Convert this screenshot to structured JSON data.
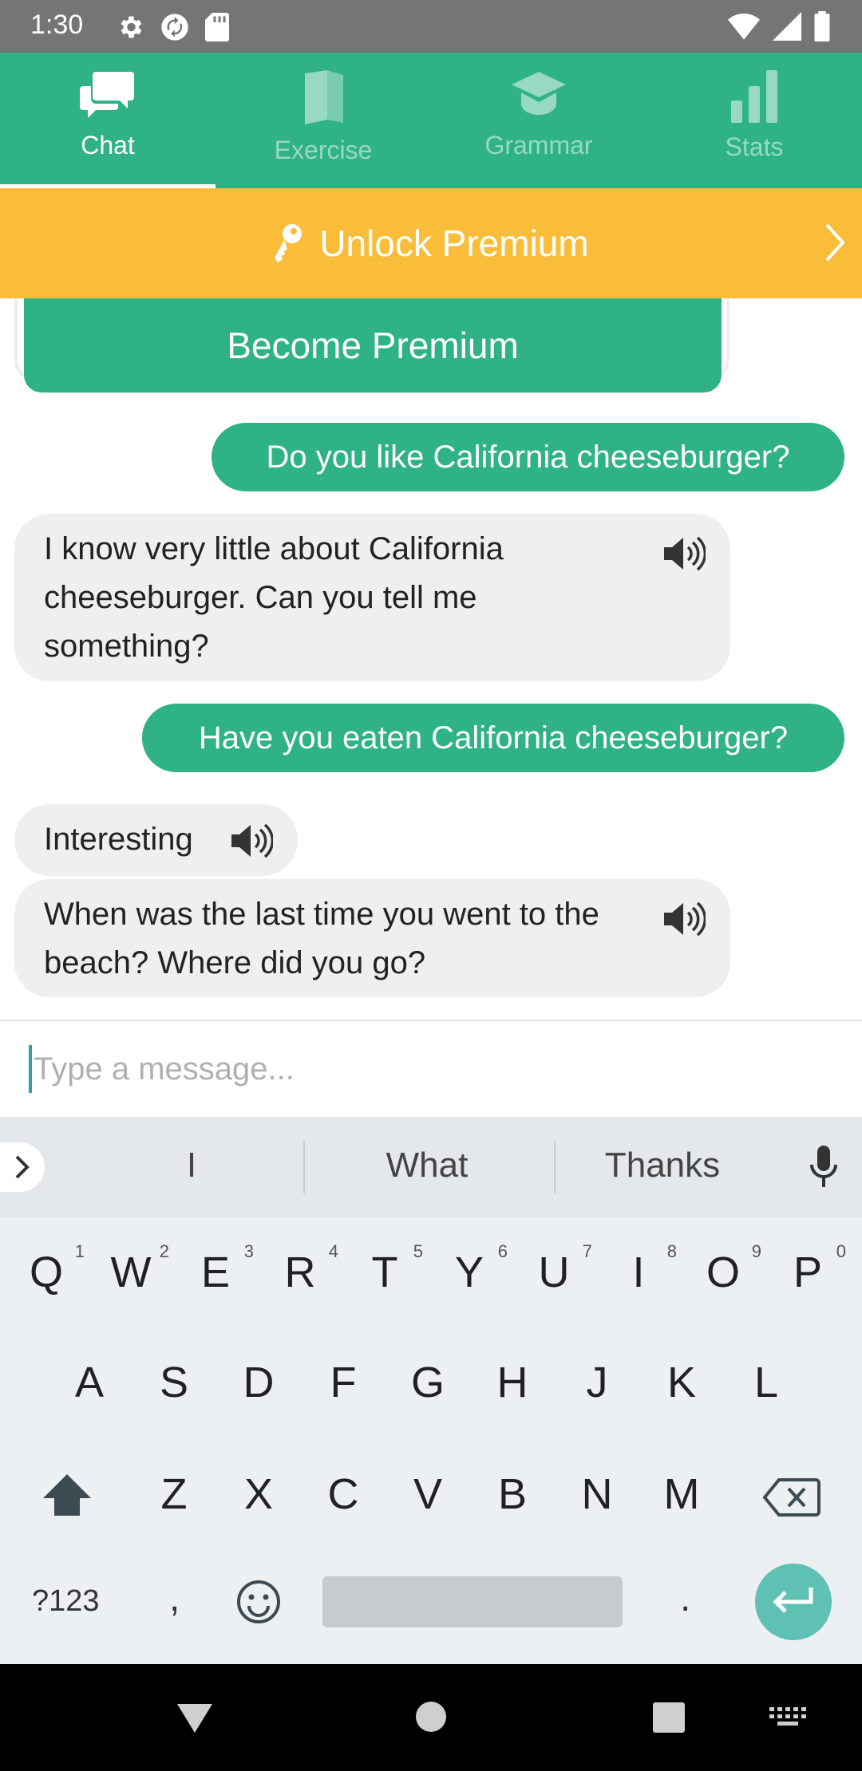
{
  "status_bar": {
    "time": "1:30",
    "icons": [
      "gear-icon",
      "sync-icon",
      "sd-card-icon",
      "wifi-icon",
      "signal-icon",
      "battery-icon"
    ]
  },
  "tabs": [
    {
      "label": "Chat",
      "icon": "chat-icon",
      "active": true
    },
    {
      "label": "Exercise",
      "icon": "book-icon",
      "active": false
    },
    {
      "label": "Grammar",
      "icon": "graduation-cap-icon",
      "active": false
    },
    {
      "label": "Stats",
      "icon": "bar-chart-icon",
      "active": false
    }
  ],
  "banner": {
    "text": "Unlock Premium",
    "icon": "key-icon"
  },
  "premium_card": {
    "button_label": "Become Premium"
  },
  "messages": [
    {
      "from": "user",
      "text": "Do you like California cheeseburger?"
    },
    {
      "from": "bot",
      "lines": [
        "I know very little about California",
        "cheeseburger. Can you tell me",
        "something?"
      ]
    },
    {
      "from": "user",
      "text": "Have you eaten California cheeseburger?"
    },
    {
      "from": "bot",
      "lines": [
        "Interesting"
      ]
    },
    {
      "from": "bot",
      "lines": [
        "When was the last time you went to the",
        "beach? Where did you go?"
      ]
    }
  ],
  "input": {
    "placeholder": "Type a message...",
    "value": ""
  },
  "keyboard": {
    "suggestions": [
      "I",
      "What",
      "Thanks"
    ],
    "row1": [
      "Q",
      "W",
      "E",
      "R",
      "T",
      "Y",
      "U",
      "I",
      "O",
      "P"
    ],
    "row1_digits": [
      "1",
      "2",
      "3",
      "4",
      "5",
      "6",
      "7",
      "8",
      "9",
      "0"
    ],
    "row2": [
      "A",
      "S",
      "D",
      "F",
      "G",
      "H",
      "J",
      "K",
      "L"
    ],
    "row3": [
      "Z",
      "X",
      "C",
      "V",
      "B",
      "N",
      "M"
    ],
    "symbols_label": "?123",
    "comma": ",",
    "period": "."
  },
  "colors": {
    "primary": "#2fb286",
    "banner": "#f9bd3a",
    "bubble_bot": "#efefef"
  }
}
